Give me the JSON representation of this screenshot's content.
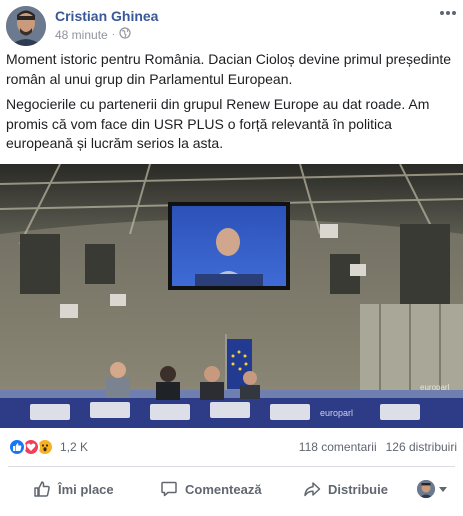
{
  "post": {
    "author": "Cristian Ghinea",
    "time": "48 minute",
    "audience_icon": "globe-icon",
    "paragraphs": [
      "Moment istoric pentru România. Dacian Cioloș devine primul președinte român al unui grup din Parlamentul European.",
      "Negocierile cu partenerii din grupul Renew Europe au dat roade. Am promis că vom face din USR PLUS o forță relevantă în politica europeană și lucrăm serios la asta."
    ],
    "photo_signs": [
      "europarl",
      "europarl"
    ]
  },
  "stats": {
    "reaction_icons": [
      "like-icon",
      "love-icon",
      "wow-icon"
    ],
    "reaction_count": "1,2 K",
    "comments": "118 comentarii",
    "shares": "126 distribuiri"
  },
  "actions": {
    "like": "Îmi place",
    "comment": "Comentează",
    "share": "Distribuie"
  },
  "colors": {
    "link": "#385898",
    "secondary": "#606770",
    "like": "#1877f2",
    "love": "#f33e58",
    "wow": "#f7b125"
  }
}
